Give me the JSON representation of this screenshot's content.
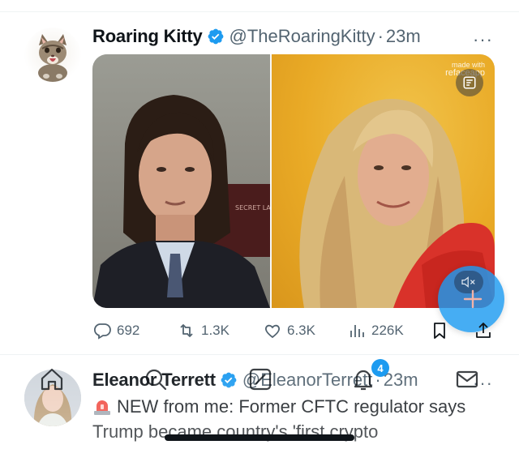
{
  "tweet1": {
    "name": "Roaring Kitty",
    "handle": "@TheRoaringKitty",
    "separator": "·",
    "time": "23m",
    "more": "···",
    "media": {
      "watermark_line1": "made with",
      "watermark_line2": "refaceapp",
      "studio_sign": "SECRET LAB"
    },
    "actions": {
      "replies": "692",
      "retweets": "1.3K",
      "likes": "6.3K",
      "views": "226K"
    }
  },
  "tweet2": {
    "name": "Eleanor Terrett",
    "handle": "@EleanorTerrett",
    "separator": "·",
    "time": "23m",
    "more": "···",
    "text": "NEW from me: Former CFTC regulator says Trump became country's 'first crypto"
  },
  "nav": {
    "notification_badge": "4"
  },
  "colors": {
    "accent": "#1d9bf0",
    "text_primary": "#0f1419",
    "text_secondary": "#536471",
    "divider": "#eff3f4"
  },
  "icons": {
    "verified": "verified-badge-icon",
    "reply": "reply-icon",
    "retweet": "retweet-icon",
    "like": "heart-icon",
    "views": "views-chart-icon",
    "bookmark": "bookmark-icon",
    "share": "share-icon",
    "compose": "plus-icon",
    "mute": "muted-speaker-icon",
    "remix": "remix-icon",
    "home": "home-icon",
    "search": "search-icon",
    "grok": "grok-icon",
    "notifications": "bell-icon",
    "messages": "mail-icon"
  }
}
